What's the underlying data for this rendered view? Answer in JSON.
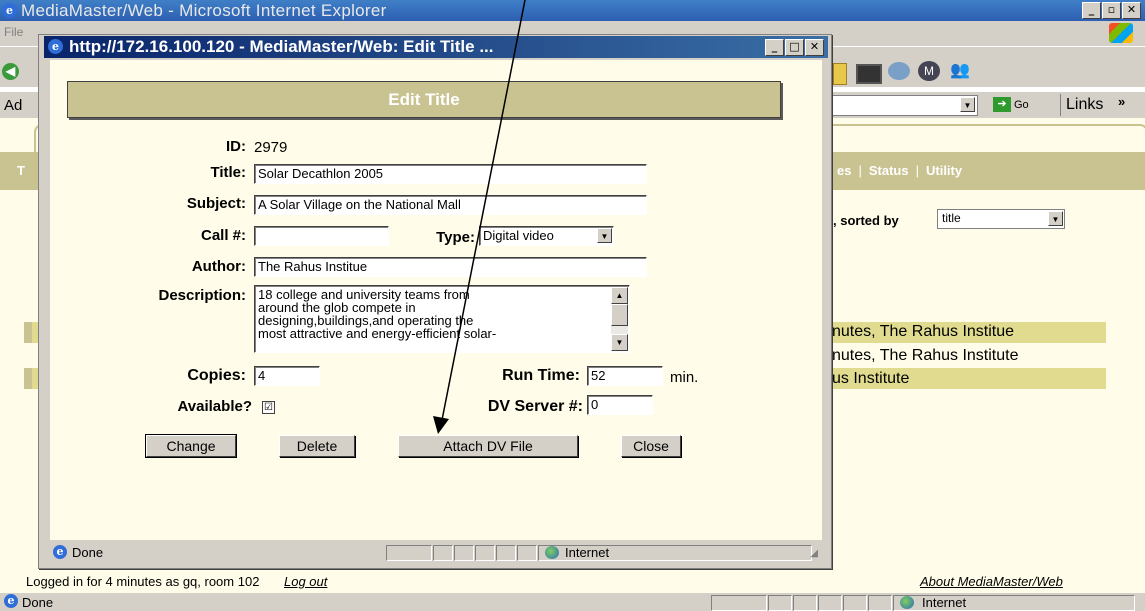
{
  "outer_window": {
    "title": "MediaMaster/Web - Microsoft Internet Explorer",
    "menu_partial": "File",
    "address_label": "Ad",
    "go_label": "Go",
    "links_label": "Links"
  },
  "page_nav": {
    "partial_items": [
      "es",
      "Status",
      "Utility"
    ],
    "left_partial": "T"
  },
  "sort": {
    "label": ", sorted by",
    "value": "title"
  },
  "result_rows": [
    "nutes, The Rahus Institue",
    "nutes, The Rahus Institute",
    "us Institute"
  ],
  "footer": {
    "logged_in_text": "Logged in for 4 minutes as gq, room 102",
    "logout_link": "Log out",
    "about_link": "About MediaMaster/Web"
  },
  "outer_status": {
    "text": "Done",
    "zone": "Internet"
  },
  "popup": {
    "title": "http://172.16.100.120 - MediaMaster/Web: Edit Title ...",
    "header": "Edit Title",
    "fields": {
      "id_label": "ID:",
      "id_value": "2979",
      "title_label": "Title:",
      "title_value": "Solar Decathlon 2005",
      "subject_label": "Subject:",
      "subject_value": "A Solar Village on the National Mall",
      "call_label": "Call #:",
      "call_value": "",
      "type_label": "Type:",
      "type_value": "Digital video",
      "author_label": "Author:",
      "author_value": "The Rahus Institue",
      "description_label": "Description:",
      "description_lines": [
        "18 college and university teams from",
        "around the glob compete in",
        "designing,buildings,and operating the",
        "most attractive and energy-efficient solar-"
      ],
      "copies_label": "Copies:",
      "copies_value": "4",
      "runtime_label": "Run Time:",
      "runtime_value": "52",
      "runtime_unit": "min.",
      "available_label": "Available?",
      "available_checked": "☑",
      "dv_server_label": "DV Server #:",
      "dv_server_value": "0"
    },
    "buttons": {
      "change": "Change",
      "delete": "Delete",
      "attach": "Attach DV File",
      "close": "Close"
    },
    "status": {
      "text": "Done",
      "zone": "Internet"
    }
  }
}
